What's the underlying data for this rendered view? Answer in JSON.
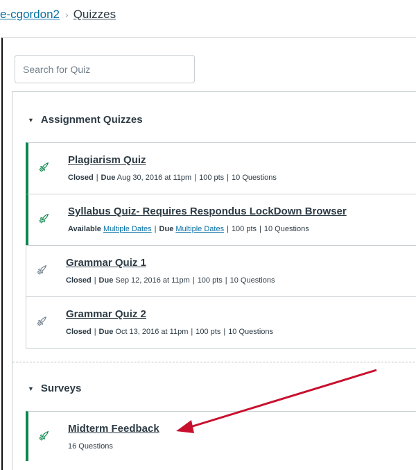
{
  "breadcrumb": {
    "course": "e-cgordon2",
    "separator": "›",
    "current": "Quizzes"
  },
  "search": {
    "placeholder": "Search for Quiz",
    "value": ""
  },
  "groups": [
    {
      "title": "Assignment Quizzes",
      "items": [
        {
          "title": "Plagiarism Quiz",
          "status": "Closed",
          "due_label": "Due",
          "due": "Aug 30, 2016 at 11pm",
          "points": "100 pts",
          "questions": "10 Questions",
          "published": true
        },
        {
          "title": "Syllabus Quiz- Requires Respondus LockDown Browser",
          "status": "Available",
          "available_link": "Multiple Dates",
          "due_label": "Due",
          "due_link": "Multiple Dates",
          "points": "100 pts",
          "questions": "10 Questions",
          "published": true
        },
        {
          "title": "Grammar Quiz 1",
          "status": "Closed",
          "due_label": "Due",
          "due": "Sep 12, 2016 at 11pm",
          "points": "100 pts",
          "questions": "10 Questions",
          "published": false
        },
        {
          "title": "Grammar Quiz 2",
          "status": "Closed",
          "due_label": "Due",
          "due": "Oct 13, 2016 at 11pm",
          "points": "100 pts",
          "questions": "10 Questions",
          "published": false
        }
      ]
    },
    {
      "title": "Surveys",
      "items": [
        {
          "title": "Midterm Feedback",
          "questions": "16 Questions",
          "published": true
        }
      ]
    }
  ],
  "colors": {
    "published": "#0b874b",
    "unpublished": "#c7cdd1",
    "link": "#0770a3",
    "annotation_arrow": "#c8102e"
  },
  "icons": {
    "publish": "rocket-icon",
    "collapse": "caret-down-icon"
  }
}
